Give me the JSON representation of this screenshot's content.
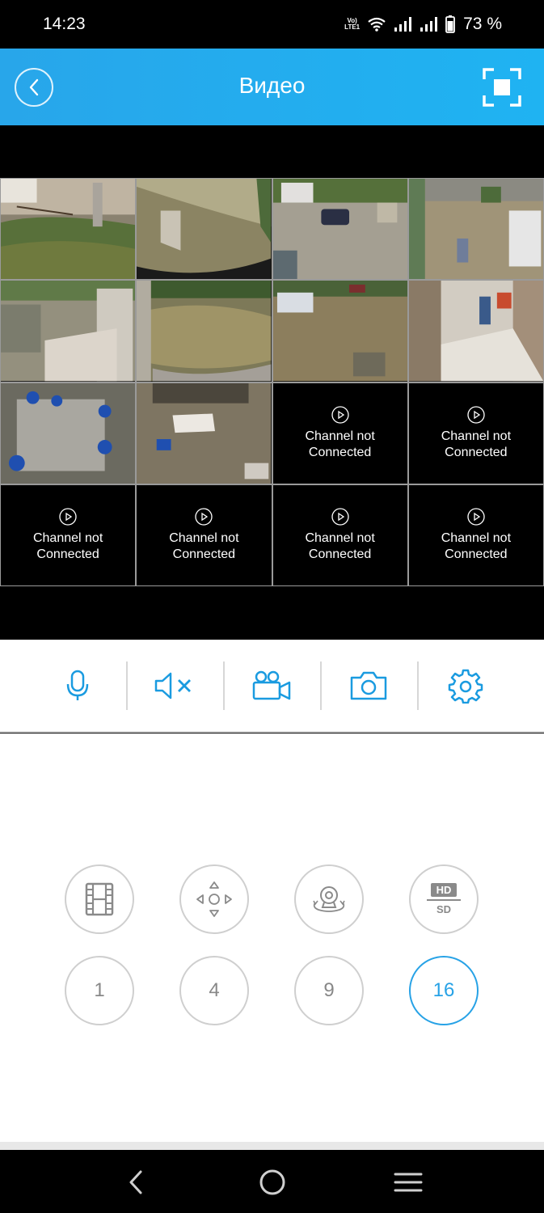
{
  "status": {
    "time": "14:23",
    "battery": "73 %",
    "volte_top": "Vo)",
    "volte_bottom": "LTE1"
  },
  "header": {
    "title": "Видео",
    "back_icon": "chevron-left-icon",
    "fullscreen_icon": "fullscreen-icon",
    "color": "#28a6ea"
  },
  "grid": {
    "channels": [
      {
        "label": "",
        "connected": true
      },
      {
        "label": "",
        "connected": true
      },
      {
        "label": "",
        "connected": true
      },
      {
        "label": "",
        "connected": true
      },
      {
        "label": "",
        "connected": true
      },
      {
        "label": "",
        "connected": true
      },
      {
        "label": "",
        "connected": true
      },
      {
        "label": "",
        "connected": true
      },
      {
        "label": "",
        "connected": true
      },
      {
        "label": "",
        "connected": true
      },
      {
        "label": "Channel not\nConnected",
        "connected": false
      },
      {
        "label": "Channel not\nConnected",
        "connected": false
      },
      {
        "label": "Channel not\nConnected",
        "connected": false
      },
      {
        "label": "Channel not\nConnected",
        "connected": false
      },
      {
        "label": "Channel not\nConnected",
        "connected": false
      },
      {
        "label": "Channel not\nConnected",
        "connected": false
      }
    ]
  },
  "toolbar": {
    "icons": [
      "microphone-icon",
      "speaker-muted-icon",
      "video-record-icon",
      "camera-snapshot-icon",
      "settings-gear-icon"
    ],
    "accent": "#1a9be0"
  },
  "controls": {
    "icons": [
      "playback-film-icon",
      "ptz-direction-icon",
      "fisheye-view-icon",
      "hd-sd-icon"
    ],
    "hd_label": "HD",
    "sd_label": "SD",
    "layouts": [
      {
        "label": "1",
        "active": false
      },
      {
        "label": "4",
        "active": false
      },
      {
        "label": "9",
        "active": false
      },
      {
        "label": "16",
        "active": true
      }
    ]
  },
  "nav": {
    "icons": [
      "back-nav-icon",
      "home-nav-icon",
      "recents-nav-icon"
    ]
  }
}
